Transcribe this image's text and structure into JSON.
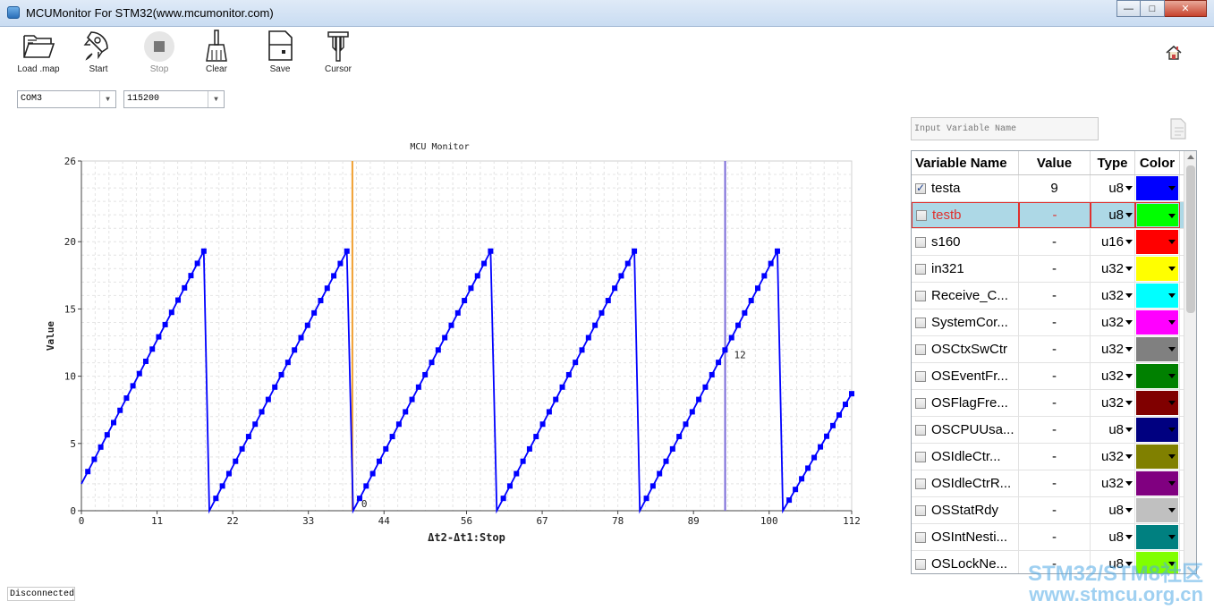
{
  "window": {
    "title": "MCUMonitor For STM32(www.mcumonitor.com)"
  },
  "toolbar": {
    "load_label": "Load .map",
    "start_label": "Start",
    "stop_label": "Stop",
    "clear_label": "Clear",
    "save_label": "Save",
    "cursor_label": "Cursor"
  },
  "connection": {
    "port": "COM3",
    "baud": "115200"
  },
  "variable_search": {
    "placeholder": "Input Variable Name"
  },
  "table": {
    "headers": {
      "name": "Variable Name",
      "value": "Value",
      "type": "Type",
      "color": "Color"
    },
    "rows": [
      {
        "name": "testa",
        "value": "9",
        "type": "u8",
        "color": "#0000ff",
        "checked": true
      },
      {
        "name": "testb",
        "value": "-",
        "type": "u8",
        "color": "#00ff00",
        "checked": false,
        "selected": true
      },
      {
        "name": "s160",
        "value": "-",
        "type": "u16",
        "color": "#ff0000",
        "checked": false
      },
      {
        "name": "in321",
        "value": "-",
        "type": "u32",
        "color": "#ffff00",
        "checked": false
      },
      {
        "name": "Receive_C...",
        "value": "-",
        "type": "u32",
        "color": "#00ffff",
        "checked": false
      },
      {
        "name": "SystemCor...",
        "value": "-",
        "type": "u32",
        "color": "#ff00ff",
        "checked": false
      },
      {
        "name": "OSCtxSwCtr",
        "value": "-",
        "type": "u32",
        "color": "#808080",
        "checked": false
      },
      {
        "name": "OSEventFr...",
        "value": "-",
        "type": "u32",
        "color": "#008000",
        "checked": false
      },
      {
        "name": "OSFlagFre...",
        "value": "-",
        "type": "u32",
        "color": "#800000",
        "checked": false
      },
      {
        "name": "OSCPUUsa...",
        "value": "-",
        "type": "u8",
        "color": "#000080",
        "checked": false
      },
      {
        "name": "OSIdleCtr...",
        "value": "-",
        "type": "u32",
        "color": "#808000",
        "checked": false
      },
      {
        "name": "OSIdleCtrR...",
        "value": "-",
        "type": "u32",
        "color": "#800080",
        "checked": false
      },
      {
        "name": "OSStatRdy",
        "value": "-",
        "type": "u8",
        "color": "#c0c0c0",
        "checked": false
      },
      {
        "name": "OSIntNesti...",
        "value": "-",
        "type": "u8",
        "color": "#008080",
        "checked": false
      },
      {
        "name": "OSLockNe...",
        "value": "-",
        "type": "u8",
        "color": "#80ff00",
        "checked": false
      }
    ]
  },
  "status": {
    "text": "Disconnected"
  },
  "watermark": {
    "line1": "STM32/STM8社区",
    "line2": "www.stmcu.org.cn"
  },
  "chart_data": {
    "type": "line",
    "title": "MCU Monitor",
    "xlabel": "Δt2-Δt1:Stop",
    "ylabel": "Value",
    "xlim": [
      0,
      112
    ],
    "ylim": [
      0,
      26
    ],
    "x_ticks": [
      "0",
      "11",
      "22",
      "33",
      "44",
      "56",
      "67",
      "78",
      "89",
      "100",
      "112"
    ],
    "y_ticks": [
      "0",
      "5",
      "10",
      "15",
      "20",
      "26"
    ],
    "grid": true,
    "series": [
      {
        "color": "#0000ff",
        "segments": [
          {
            "x_start": 0,
            "x_end": 17.8,
            "y_start": 2,
            "y_end": 19.3
          },
          {
            "x_start": 18.6,
            "x_end": 38.6,
            "y_start": 0,
            "y_end": 19.3
          },
          {
            "x_start": 39.5,
            "x_end": 59.5,
            "y_start": 0,
            "y_end": 19.3
          },
          {
            "x_start": 60.4,
            "x_end": 80.4,
            "y_start": 0,
            "y_end": 19.3
          },
          {
            "x_start": 81.2,
            "x_end": 101.2,
            "y_start": 0,
            "y_end": 19.3
          },
          {
            "x_start": 102.0,
            "x_end": 112,
            "y_start": 0,
            "y_end": 8.7
          }
        ]
      }
    ],
    "cursors": [
      {
        "x": 39.4,
        "label": "0",
        "color": "#f0a030"
      },
      {
        "x": 93.6,
        "label": "12",
        "color": "#7a6ad8"
      }
    ]
  }
}
